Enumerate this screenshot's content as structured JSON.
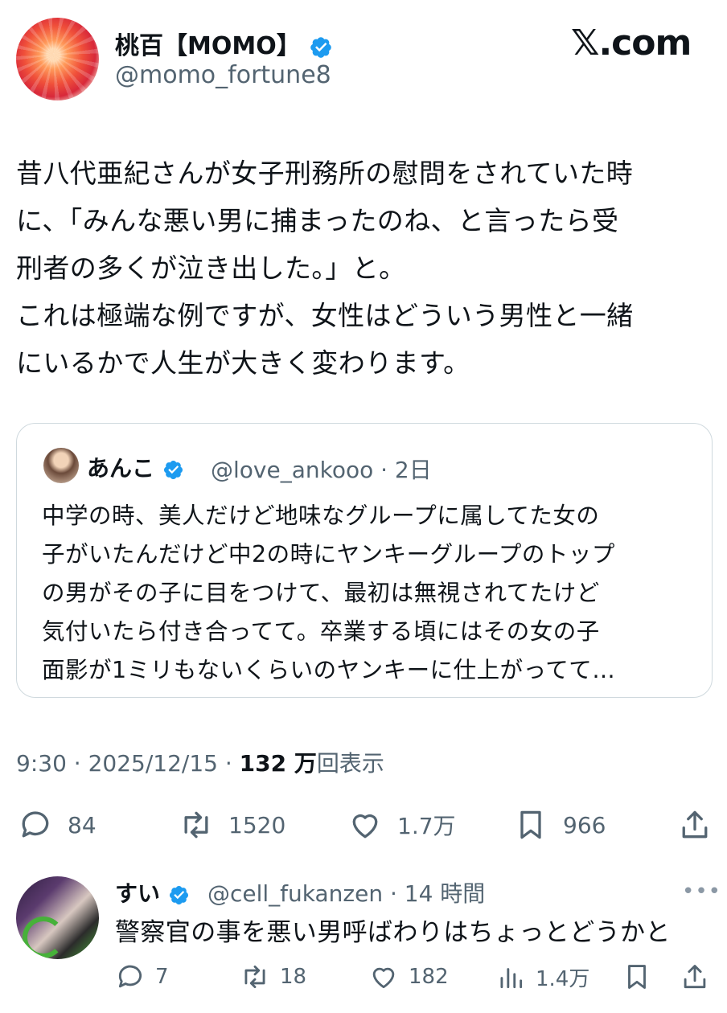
{
  "author": {
    "name": "桃百【MOMO】",
    "handle": "@momo_fortune8"
  },
  "site_label": "𝕏.com",
  "post": {
    "text": "昔八代亜紀さんが女子刑務所の慰問をされていた時\nに、「みんな悪い男に捕まったのね、と言ったら受\n刑者の多くが泣き出した。」と。\nこれは極端な例ですが、女性はどういう男性と一緒\nにいるかで人生が大きく変わります。",
    "time": "9:30 · 2025/12/15 · ",
    "views_count": "132 万",
    "views_label": "回表示"
  },
  "quote": {
    "name": "あんこ",
    "handle_time": "@love_ankooo · 2日",
    "text": "中学の時、美人だけど地味なグループに属してた女の\n子がいたんだけど中2の時にヤンキーグループのトップ\nの男がその子に目をつけて、最初は無視されてたけど\n気付いたら付き合ってて。卒業する頃にはその女の子\n面影が1ミリもないくらいのヤンキーに仕上がってて…"
  },
  "actions": {
    "replies": "84",
    "reposts": "1520",
    "likes": "1.7万",
    "bookmarks": "966"
  },
  "reply": {
    "name": "すい",
    "handle_time": "@cell_fukanzen · 14 時間",
    "more": "•••",
    "text": "警察官の事を悪い男呼ばわりはちょっとどうかと",
    "replies": "7",
    "reposts": "18",
    "likes": "182",
    "views": "1.4万"
  },
  "colors": {
    "verified": "#1d9bf0",
    "text": "#0f1419",
    "muted": "#536471",
    "border": "#cfd9de"
  }
}
